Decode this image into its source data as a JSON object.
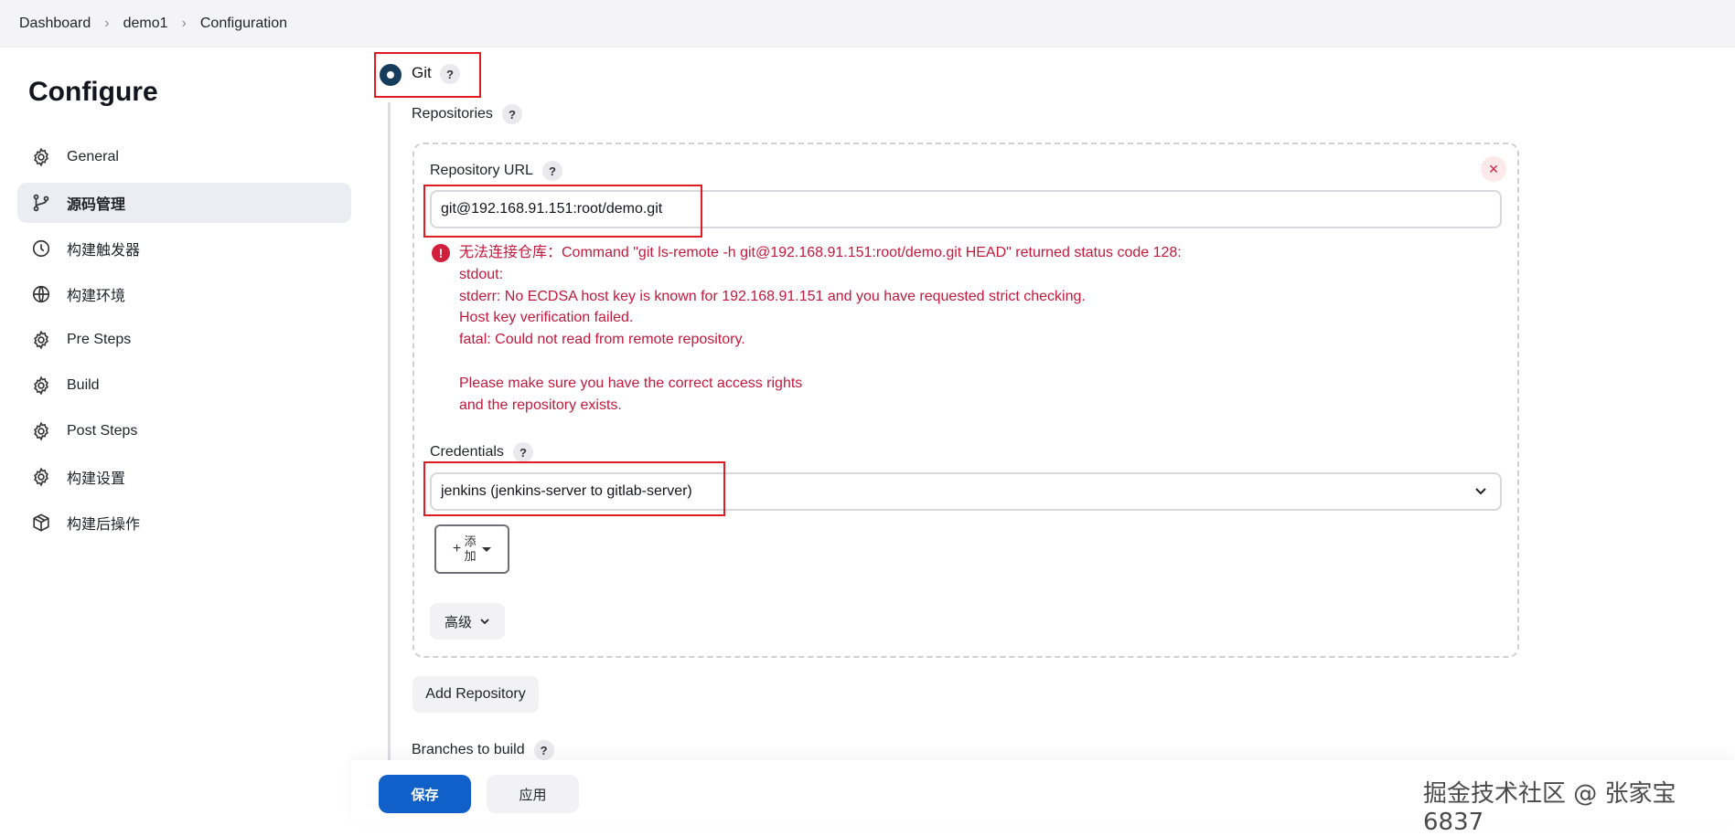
{
  "breadcrumb": [
    "Dashboard",
    "demo1",
    "Configuration"
  ],
  "sidebar": {
    "title": "Configure",
    "items": [
      {
        "label": "General",
        "icon": "gear-icon"
      },
      {
        "label": "源码管理",
        "icon": "branch-icon",
        "active": true
      },
      {
        "label": "构建触发器",
        "icon": "clock-icon"
      },
      {
        "label": "构建环境",
        "icon": "globe-icon"
      },
      {
        "label": "Pre Steps",
        "icon": "gear-icon"
      },
      {
        "label": "Build",
        "icon": "gear-icon"
      },
      {
        "label": "Post Steps",
        "icon": "gear-icon"
      },
      {
        "label": "构建设置",
        "icon": "gear-icon"
      },
      {
        "label": "构建后操作",
        "icon": "package-icon"
      }
    ]
  },
  "scm": {
    "option_label": "Git",
    "help": "?",
    "repositories_label": "Repositories",
    "repo_url_label": "Repository URL",
    "repo_url_value": "git@192.168.91.151:root/demo.git",
    "close_symbol": "×",
    "error_icon": "!",
    "error_lines": [
      "无法连接仓库：Command \"git ls-remote -h git@192.168.91.151:root/demo.git HEAD\" returned status code 128:",
      "stdout:",
      "stderr: No ECDSA host key is known for 192.168.91.151 and you have requested strict checking.",
      "Host key verification failed.",
      "fatal: Could not read from remote repository.",
      "",
      "Please make sure you have the correct access rights",
      "and the repository exists."
    ],
    "credentials_label": "Credentials",
    "credentials_value": "jenkins (jenkins-server to gitlab-server)",
    "add_plus": "+",
    "add_label": "添加",
    "advanced_label": "高级",
    "add_repository_label": "Add Repository",
    "branches_label": "Branches to build"
  },
  "actions": {
    "save_label": "保存",
    "apply_label": "应用"
  },
  "watermark": "掘金技术社区 @ 张家宝6837",
  "colors": {
    "primary": "#1160c9",
    "error": "#c4183c",
    "highlight_box": "#e01b22",
    "radio": "#173d5c"
  }
}
